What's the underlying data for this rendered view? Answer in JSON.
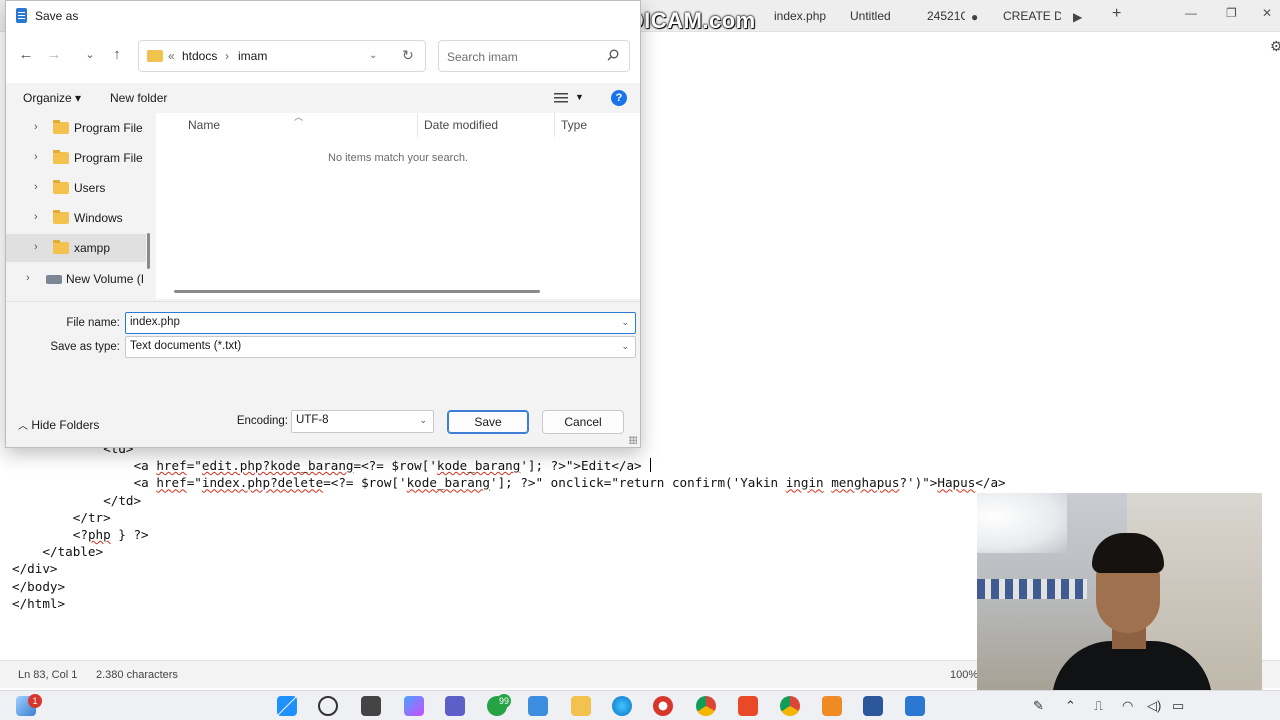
{
  "notepad": {
    "tabs": [
      "index.php",
      "Untitled",
      "24521C",
      "CREATE DA"
    ],
    "new_tab": "+",
    "code_lines": [
      {
        "indent": 12,
        "parts": [
          {
            "t": "<td>"
          }
        ]
      },
      {
        "indent": 16,
        "parts": [
          {
            "t": "<a "
          },
          {
            "t": "href",
            "sq": true
          },
          {
            "t": "=\""
          },
          {
            "t": "edit.php?kode_barang",
            "sq": true
          },
          {
            "t": "=<?= $row['"
          },
          {
            "t": "kode_barang",
            "sq": true
          },
          {
            "t": "']; ?>\">Edit</a>"
          }
        ],
        "caret": true
      },
      {
        "indent": 16,
        "parts": [
          {
            "t": "<a "
          },
          {
            "t": "href",
            "sq": true
          },
          {
            "t": "=\""
          },
          {
            "t": "index.php?delete",
            "sq": true
          },
          {
            "t": "=<?= $row['"
          },
          {
            "t": "kode_barang",
            "sq": true
          },
          {
            "t": "']; ?>\" onclick=\"return confirm('Yakin "
          },
          {
            "t": "ingin",
            "sq": true
          },
          {
            "t": " "
          },
          {
            "t": "menghapus",
            "sq": true
          },
          {
            "t": "?')\">"
          },
          {
            "t": "Hapus",
            "sq": true
          },
          {
            "t": "</a>"
          }
        ]
      },
      {
        "indent": 12,
        "parts": [
          {
            "t": "</td>"
          }
        ]
      },
      {
        "indent": 8,
        "parts": [
          {
            "t": "</tr>"
          }
        ]
      },
      {
        "indent": 8,
        "parts": [
          {
            "t": "<?"
          },
          {
            "t": "php",
            "sq": true
          },
          {
            "t": " } ?>"
          }
        ]
      },
      {
        "indent": 4,
        "parts": [
          {
            "t": "</table>"
          }
        ]
      },
      {
        "indent": 0,
        "parts": [
          {
            "t": "</div>"
          }
        ]
      },
      {
        "indent": 0,
        "parts": [
          {
            "t": "</body>"
          }
        ]
      },
      {
        "indent": 0,
        "parts": [
          {
            "t": "</html>"
          }
        ]
      }
    ],
    "status": {
      "position": "Ln 83, Col 1",
      "chars": "2.380 characters",
      "zoom": "100%"
    }
  },
  "watermark": "www.BANDICAM.com",
  "dialog": {
    "title": "Save as",
    "breadcrumb": {
      "overflow": "«",
      "segments": [
        "htdocs",
        "imam"
      ]
    },
    "search_placeholder": "Search imam",
    "organize": "Organize ▾",
    "new_folder": "New folder",
    "help": "?",
    "tree": [
      {
        "label": "Program File",
        "chevron": "›"
      },
      {
        "label": "Program File",
        "chevron": "›"
      },
      {
        "label": "Users",
        "chevron": "›"
      },
      {
        "label": "Windows",
        "chevron": "›"
      },
      {
        "label": "xampp",
        "chevron": "›"
      },
      {
        "label": "New Volume (I",
        "chevron": "›"
      }
    ],
    "columns": {
      "name": "Name",
      "date": "Date modified",
      "type": "Type"
    },
    "empty_message": "No items match your search.",
    "file_name_label": "File name:",
    "file_name_value": "index.php",
    "save_type_label": "Save as type:",
    "save_type_value": "Text documents (*.txt)",
    "hide_folders": "Hide Folders",
    "encoding_label": "Encoding:",
    "encoding_value": "UTF-8",
    "save_button": "Save",
    "cancel_button": "Cancel"
  },
  "taskbar": {
    "badges": {
      "notif": "1",
      "chat": "99"
    },
    "colors": {
      "accent": "#2a7bd6",
      "taskbar_bg": "#eef0f3"
    }
  }
}
